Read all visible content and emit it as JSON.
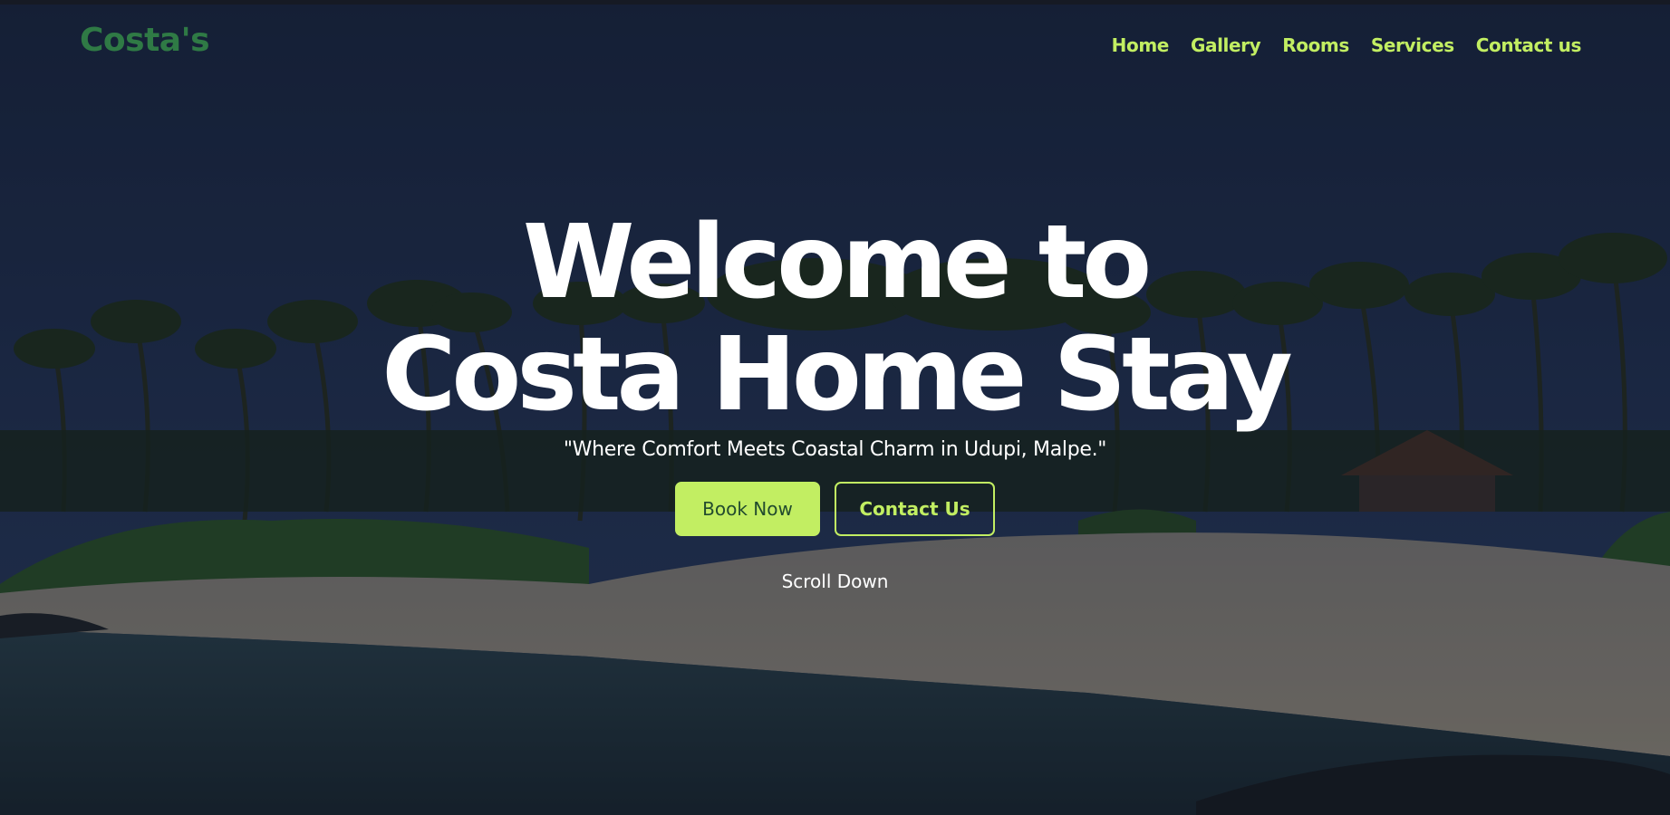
{
  "brand": {
    "logo_text": "Costa's"
  },
  "nav": {
    "items": [
      {
        "label": "Home"
      },
      {
        "label": "Gallery"
      },
      {
        "label": "Rooms"
      },
      {
        "label": "Services"
      },
      {
        "label": "Contact us"
      }
    ]
  },
  "hero": {
    "headline_line1": "Welcome to",
    "headline_line2": "Costa Home Stay",
    "tagline": "\"Where Comfort Meets Coastal Charm in Udupi, Malpe.\"",
    "primary_button": "Book Now",
    "secondary_button": "Contact Us",
    "scroll_label": "Scroll Down",
    "background_description_icon": "beach-palm-trees-photo"
  },
  "colors": {
    "accent": "#c2ee62",
    "logo": "#2f7a45",
    "primary_button_text": "#224b2e",
    "heading": "#ffffff"
  }
}
